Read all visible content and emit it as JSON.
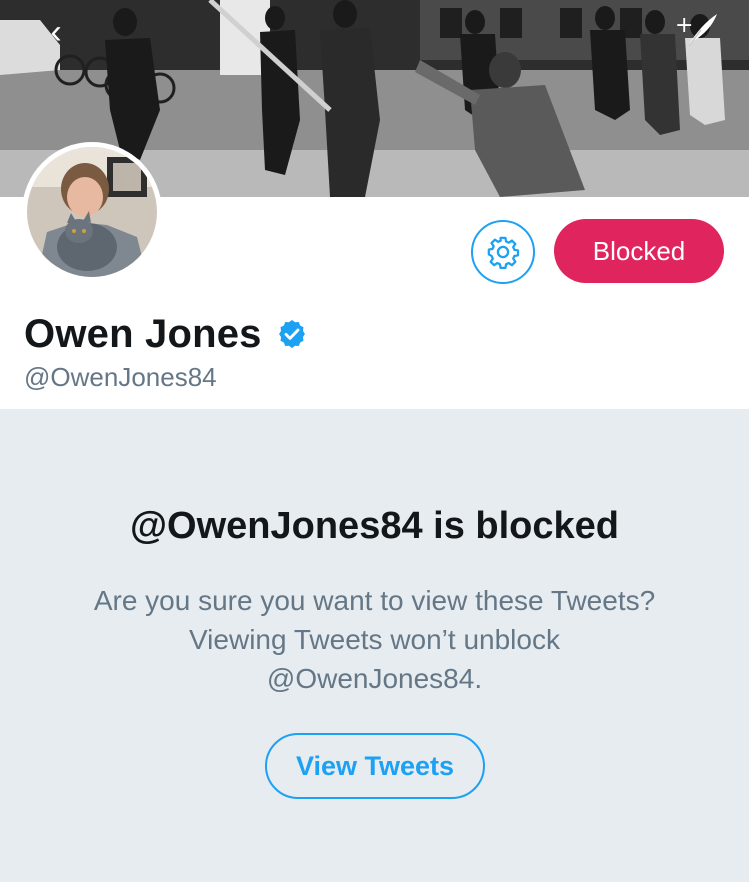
{
  "profile": {
    "display_name": "Owen Jones",
    "verified": true,
    "handle": "@OwenJones84"
  },
  "actions": {
    "settings_icon": "gear-icon",
    "blocked_label": "Blocked"
  },
  "nav": {
    "back_icon": "chevron-left-icon",
    "compose_icon": "compose-tweet-icon"
  },
  "blocked_panel": {
    "title": "@OwenJones84 is blocked",
    "description_line1": "Are you sure you want to view these Tweets?",
    "description_line2": "Viewing Tweets won’t unblock",
    "description_line3": "@OwenJones84.",
    "view_button_label": "View Tweets"
  },
  "colors": {
    "accent": "#1da1f2",
    "blocked": "#e0245e",
    "panel_bg": "#e6ecf0",
    "text_primary": "#14171a",
    "text_secondary": "#657786"
  }
}
